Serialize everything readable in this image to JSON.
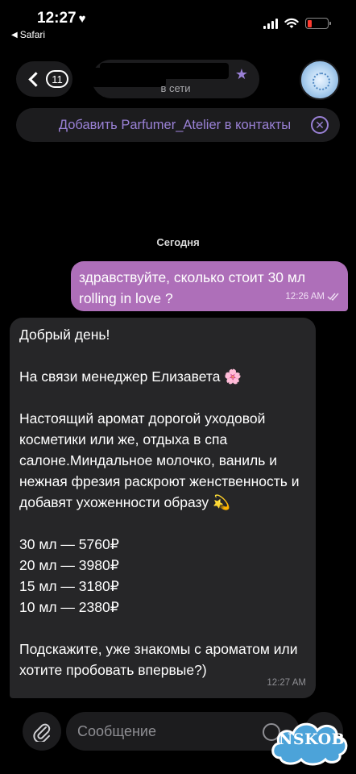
{
  "status_bar": {
    "time": "12:27",
    "back_app": "Safari"
  },
  "header": {
    "back_count": "11",
    "subtitle": "в сети"
  },
  "banner": {
    "text": "Добавить Parfumer_Atelier в контакты"
  },
  "chat": {
    "date": "Сегодня",
    "messages": [
      {
        "direction": "outgoing",
        "text": "здравствуйте, сколько стоит 30 мл rolling in love ?",
        "time": "12:26 AM"
      },
      {
        "direction": "incoming",
        "text": "Добрый день!\n\nНа связи менеджер Елизавета 🌸\n\nНастоящий аромат дорогой уходовой косметики или же, отдыха в спа салоне.Миндальное молочко, ваниль и нежная фрезия раскроют женственность и добавят ухоженности образу 💫\n\n30 мл — 5760₽\n20 мл — 3980₽\n15 мл — 3180₽\n10 мл — 2380₽\n\nПодскажите, уже знакомы с ароматом или хотите пробовать впервые?)",
        "time": "12:27 AM"
      }
    ]
  },
  "composer": {
    "placeholder": "Сообщение"
  },
  "watermark": {
    "text": "NSKOB"
  },
  "colors": {
    "accent": "#9a81d6",
    "outgoing_bubble": "#ae6fb9",
    "incoming_bubble": "#262628",
    "battery_low": "#ff3b30"
  }
}
